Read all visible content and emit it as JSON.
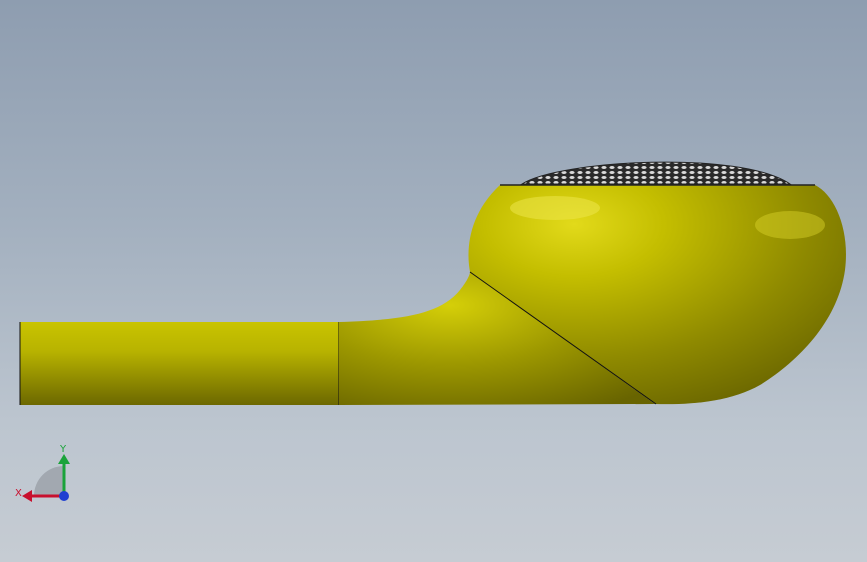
{
  "viewport": {
    "model": "earbud-model",
    "triad": {
      "x_label": "X",
      "y_label": "Y",
      "x_color": "#c8102e",
      "y_color": "#1aa33a",
      "z_color": "#1f3fd1"
    },
    "colors": {
      "body_light": "#d8d000",
      "body_mid": "#b4ae00",
      "body_dark": "#6f6b00",
      "mesh": "#2b2b2b"
    }
  }
}
